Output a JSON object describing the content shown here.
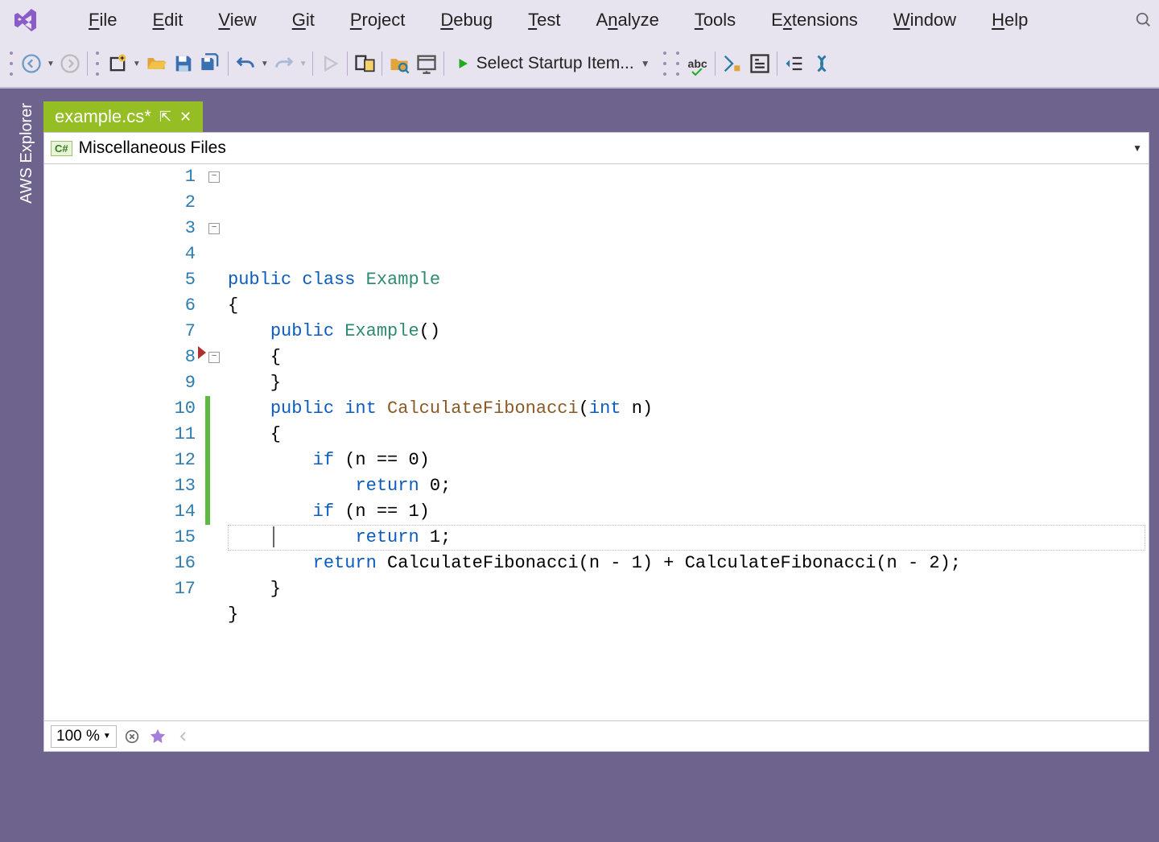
{
  "menu": {
    "items": [
      "File",
      "Edit",
      "View",
      "Git",
      "Project",
      "Debug",
      "Test",
      "Analyze",
      "Tools",
      "Extensions",
      "Window",
      "Help"
    ],
    "mnemonics": [
      "F",
      "E",
      "V",
      "G",
      "P",
      "D",
      "T",
      "n",
      "T",
      "x",
      "W",
      "H"
    ]
  },
  "toolbar": {
    "startup_label": "Select Startup Item...",
    "spellcheck_text": "abc"
  },
  "sidebar": {
    "label": "AWS Explorer"
  },
  "tab": {
    "title": "example.cs*",
    "pin_glyph": "⇱",
    "close_glyph": "✕"
  },
  "context": {
    "file_lang_badge": "C#",
    "scope": "Miscellaneous Files"
  },
  "editor": {
    "line_count": 17,
    "fold_points": [
      1,
      3,
      8
    ],
    "breakpoint_line": 8,
    "cursor_line": 15,
    "change_lines": [
      10,
      11,
      12,
      13,
      14
    ],
    "lines": [
      {
        "n": 1,
        "tokens": [
          {
            "t": "public ",
            "c": "kw"
          },
          {
            "t": "class ",
            "c": "kw"
          },
          {
            "t": "Example",
            "c": "type"
          }
        ]
      },
      {
        "n": 2,
        "tokens": [
          {
            "t": "{"
          }
        ]
      },
      {
        "n": 3,
        "tokens": [
          {
            "t": "    "
          },
          {
            "t": "public ",
            "c": "kw"
          },
          {
            "t": "Example",
            "c": "type"
          },
          {
            "t": "()"
          }
        ]
      },
      {
        "n": 4,
        "tokens": [
          {
            "t": "    {"
          }
        ]
      },
      {
        "n": 5,
        "tokens": [
          {
            "t": ""
          }
        ]
      },
      {
        "n": 6,
        "tokens": [
          {
            "t": "    }"
          }
        ]
      },
      {
        "n": 7,
        "tokens": [
          {
            "t": ""
          }
        ]
      },
      {
        "n": 8,
        "tokens": [
          {
            "t": "    "
          },
          {
            "t": "public ",
            "c": "kw"
          },
          {
            "t": "int ",
            "c": "kw"
          },
          {
            "t": "CalculateFibonacci",
            "c": "mname"
          },
          {
            "t": "("
          },
          {
            "t": "int ",
            "c": "kw"
          },
          {
            "t": "n)"
          }
        ]
      },
      {
        "n": 9,
        "tokens": [
          {
            "t": "    {"
          }
        ]
      },
      {
        "n": 10,
        "tokens": [
          {
            "t": "        "
          },
          {
            "t": "if ",
            "c": "kw"
          },
          {
            "t": "(n == "
          },
          {
            "t": "0",
            "c": "num-lit"
          },
          {
            "t": ")"
          }
        ]
      },
      {
        "n": 11,
        "tokens": [
          {
            "t": "            "
          },
          {
            "t": "return ",
            "c": "kw"
          },
          {
            "t": "0",
            "c": "num-lit"
          },
          {
            "t": ";"
          }
        ]
      },
      {
        "n": 12,
        "tokens": [
          {
            "t": "        "
          },
          {
            "t": "if ",
            "c": "kw"
          },
          {
            "t": "(n == "
          },
          {
            "t": "1",
            "c": "num-lit"
          },
          {
            "t": ")"
          }
        ]
      },
      {
        "n": 13,
        "tokens": [
          {
            "t": "            "
          },
          {
            "t": "return ",
            "c": "kw"
          },
          {
            "t": "1",
            "c": "num-lit"
          },
          {
            "t": ";"
          }
        ]
      },
      {
        "n": 14,
        "tokens": [
          {
            "t": "        "
          },
          {
            "t": "return ",
            "c": "kw"
          },
          {
            "t": "CalculateFibonacci(n - "
          },
          {
            "t": "1",
            "c": "num-lit"
          },
          {
            "t": ") + CalculateFibonacci(n - "
          },
          {
            "t": "2",
            "c": "num-lit"
          },
          {
            "t": ");"
          }
        ]
      },
      {
        "n": 15,
        "tokens": [
          {
            "t": ""
          }
        ]
      },
      {
        "n": 16,
        "tokens": [
          {
            "t": "    }"
          }
        ]
      },
      {
        "n": 17,
        "tokens": [
          {
            "t": "}"
          }
        ]
      }
    ]
  },
  "zoom": {
    "value": "100 %"
  }
}
